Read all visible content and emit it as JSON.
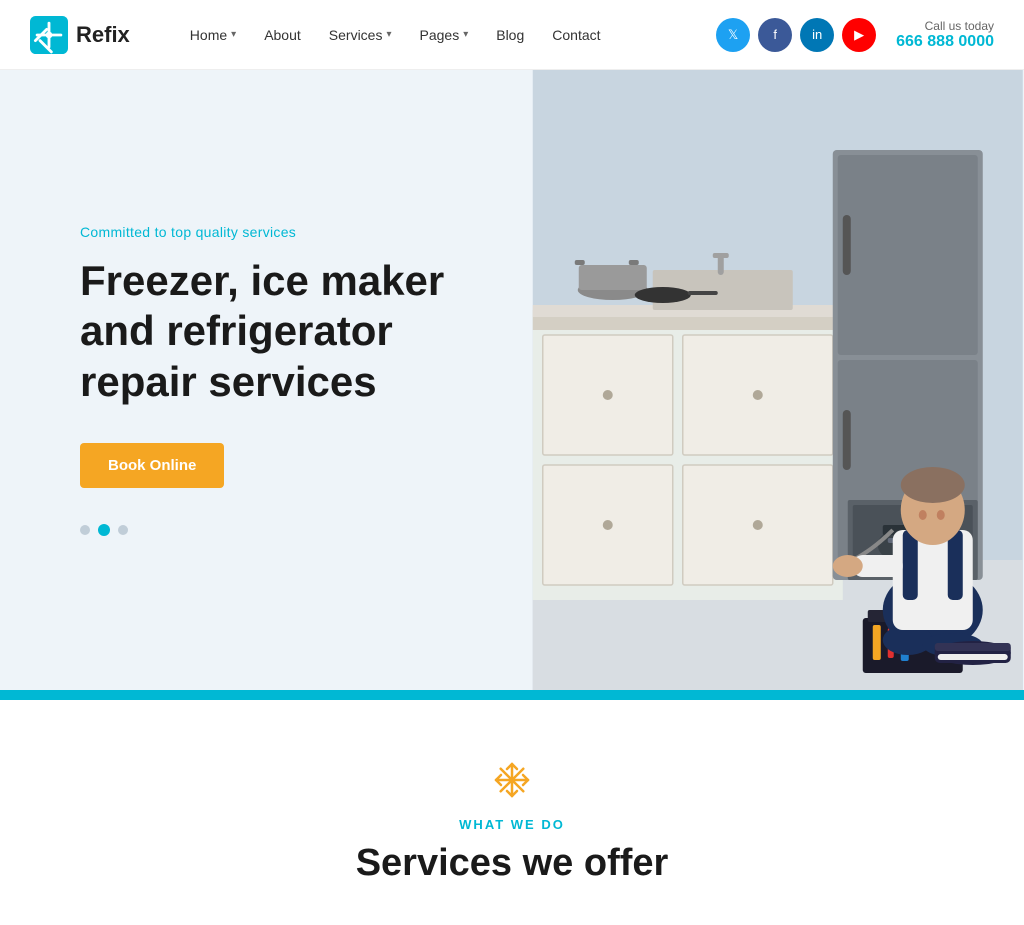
{
  "header": {
    "logo_text": "Refix",
    "nav": [
      {
        "label": "Home",
        "has_dropdown": true
      },
      {
        "label": "About",
        "has_dropdown": false
      },
      {
        "label": "Services",
        "has_dropdown": true
      },
      {
        "label": "Pages",
        "has_dropdown": true
      },
      {
        "label": "Blog",
        "has_dropdown": false
      },
      {
        "label": "Contact",
        "has_dropdown": false
      }
    ],
    "social": [
      {
        "name": "twitter",
        "icon": "𝕏",
        "class": "twitter",
        "aria": "Twitter"
      },
      {
        "name": "facebook",
        "icon": "f",
        "class": "facebook",
        "aria": "Facebook"
      },
      {
        "name": "linkedin",
        "icon": "in",
        "class": "linkedin",
        "aria": "LinkedIn"
      },
      {
        "name": "youtube",
        "icon": "▶",
        "class": "youtube",
        "aria": "YouTube"
      }
    ],
    "call_label": "Call us today",
    "call_number": "666 888 0000"
  },
  "hero": {
    "tagline": "Committed to top quality services",
    "title": "Freezer, ice maker and refrigerator repair services",
    "book_btn": "Book Online",
    "dots": [
      {
        "active": false
      },
      {
        "active": true
      },
      {
        "active": false
      }
    ]
  },
  "below": {
    "subtitle": "WHAT WE DO",
    "title": "Services we offer"
  },
  "colors": {
    "cyan": "#00b8d4",
    "orange": "#f5a623",
    "dark": "#1a1a1a"
  }
}
